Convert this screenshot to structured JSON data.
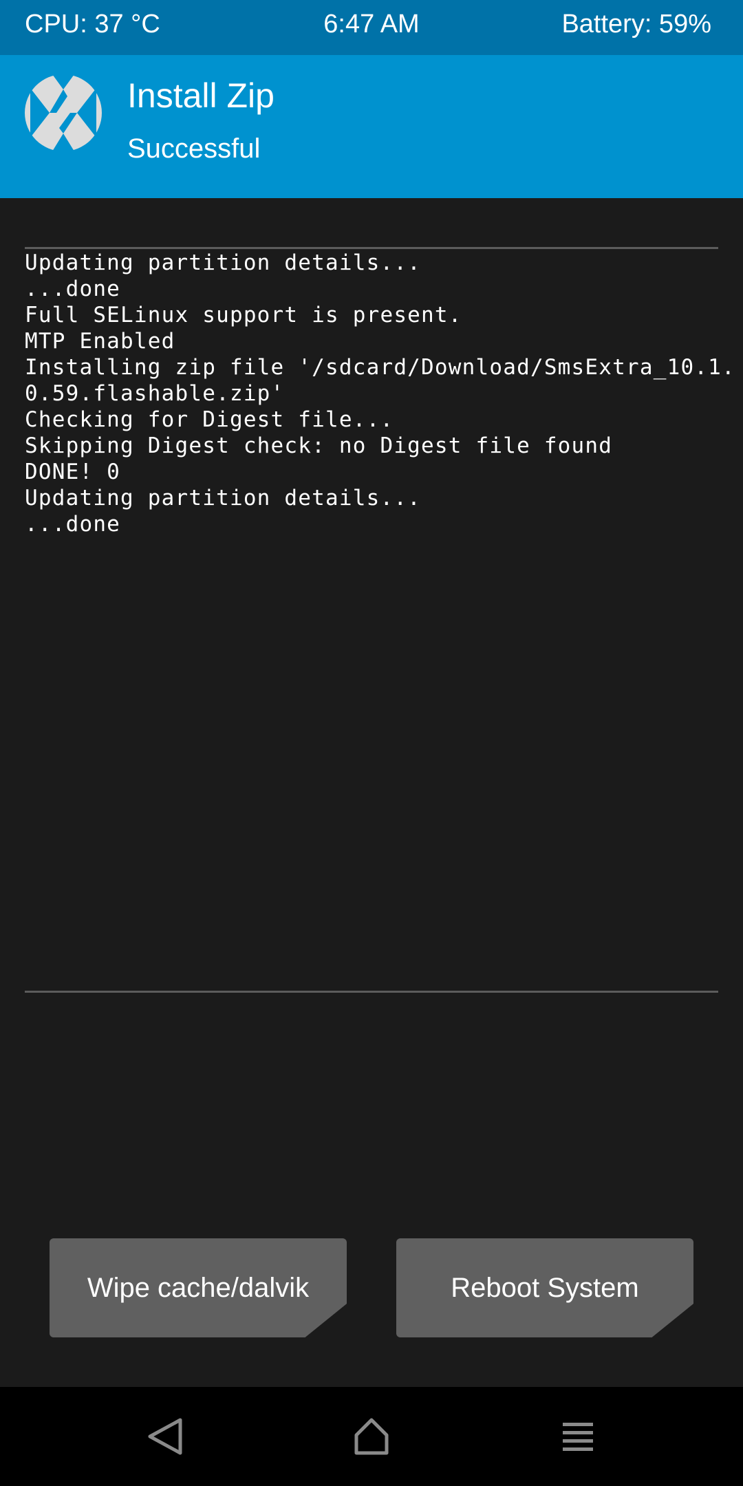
{
  "status_bar": {
    "cpu": "CPU: 37 °C",
    "time": "6:47 AM",
    "battery": "Battery: 59%"
  },
  "header": {
    "logo_icon": "twrp-logo-icon",
    "title": "Install Zip",
    "subtitle": "Successful"
  },
  "console": {
    "lines": [
      "Updating partition details...",
      "...done",
      "Full SELinux support is present.",
      "MTP Enabled",
      "Installing zip file '/sdcard/Download/SmsExtra_10.1.",
      "0.59.flashable.zip'",
      "Checking for Digest file...",
      "Skipping Digest check: no Digest file found",
      "DONE! 0",
      "Updating partition details...",
      "...done"
    ]
  },
  "actions": {
    "wipe_label": "Wipe cache/dalvik",
    "reboot_label": "Reboot System"
  },
  "nav_bar": {
    "back_icon": "back-icon",
    "home_icon": "home-icon",
    "menu_icon": "menu-icon"
  },
  "colors": {
    "status_bar": "#0072a8",
    "header": "#0092cf",
    "background": "#1b1b1b",
    "button": "#606060",
    "nav_bar": "#000000"
  }
}
